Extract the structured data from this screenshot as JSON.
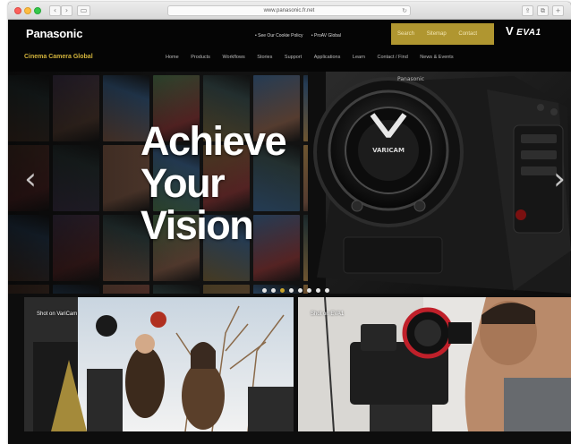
{
  "browser": {
    "url": "www.panasonic.fr.net",
    "back_glyph": "‹",
    "forward_glyph": "›",
    "sidebar_glyph": "▭",
    "reload_glyph": "↻",
    "share_glyph": "⇪",
    "tabs_glyph": "⧉",
    "new_tab_glyph": "+"
  },
  "header": {
    "logo": "Panasonic",
    "site_name": "Cinema Camera Global",
    "util_links": [
      "• See Our Cookie Policy",
      "• ProAV Global"
    ],
    "search_links": [
      "Search",
      "Sitemap",
      "Contact"
    ],
    "brand_mark": "V",
    "brand_text": "EVA1",
    "nav": [
      "Home",
      "Products",
      "Workflows",
      "Stories",
      "Support",
      "Applications",
      "Learn",
      "Contact / Find",
      "News & Events"
    ]
  },
  "hero": {
    "title_lines": [
      "Achieve",
      "Your",
      "Vision"
    ],
    "prev_glyph": "‹",
    "next_glyph": "›",
    "camera_logo": "VARICAM",
    "camera_badge": "Panasonic",
    "slide_count": 8,
    "active_slide": 2
  },
  "tiles": [
    {
      "label": "Shot on VariCam"
    },
    {
      "label": "Shot on EVA1"
    }
  ],
  "colors": {
    "accent_gold": "#b09630",
    "site_name_gold": "#d2b33c",
    "background": "#050505"
  }
}
